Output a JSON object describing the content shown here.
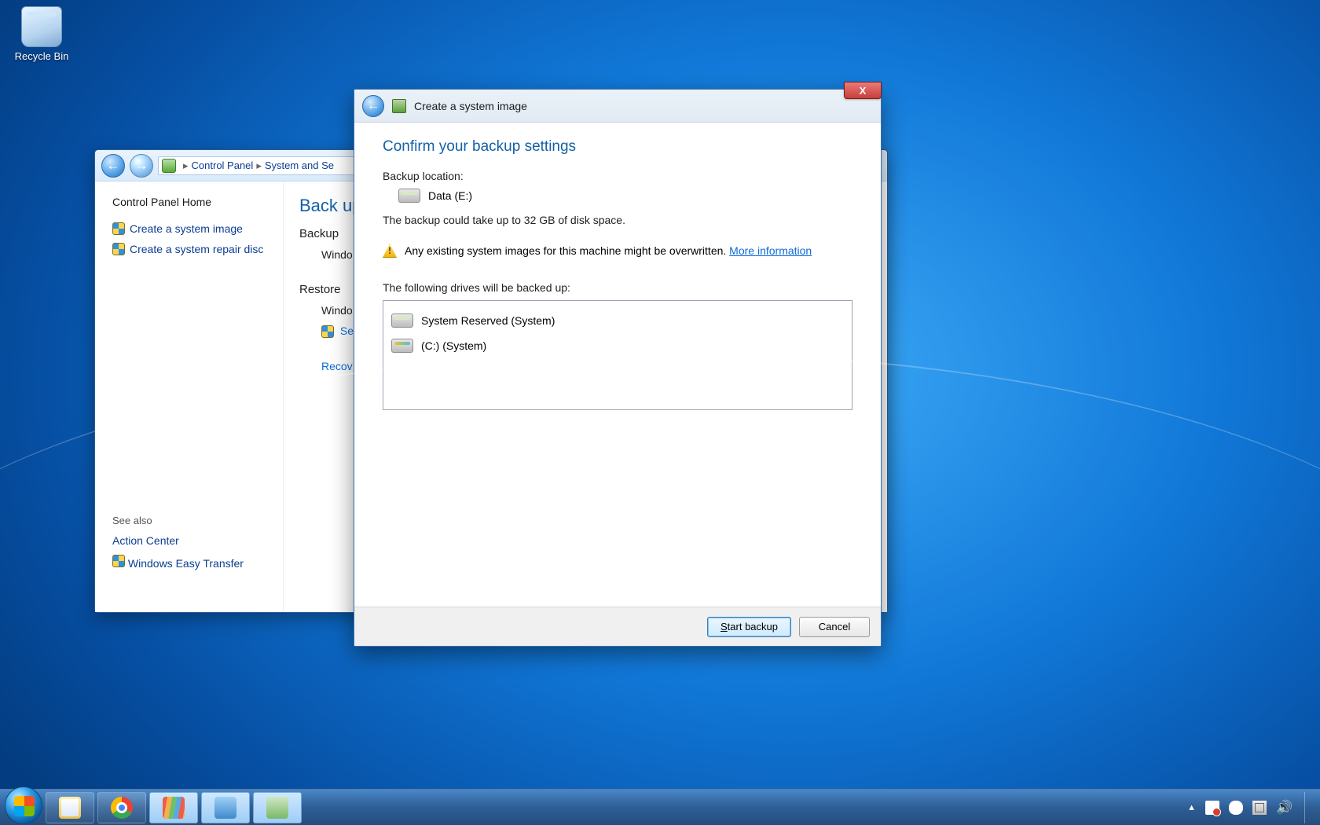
{
  "desktop": {
    "recycle_bin": "Recycle Bin"
  },
  "control_panel": {
    "breadcrumb": {
      "root": "Control Panel",
      "section": "System and Se"
    },
    "home": "Control Panel Home",
    "side_links": {
      "create_image": "Create a system image",
      "create_repair": "Create a system repair disc"
    },
    "see_also": "See also",
    "see_also_links": {
      "action_center": "Action Center",
      "easy_transfer": "Windows Easy Transfer"
    },
    "main": {
      "heading": "Back up",
      "backup_label": "Backup",
      "backup_indent": "Windo",
      "restore_label": "Restore",
      "restore_indent": "Windo",
      "select_link": "Sel",
      "recover_link": "Recov"
    }
  },
  "wizard": {
    "title": "Create a system image",
    "heading": "Confirm your backup settings",
    "backup_location_label": "Backup location:",
    "backup_location_value": "Data (E:)",
    "size_note": "The backup could take up to 32 GB of disk space.",
    "warning_text": "Any existing system images for this machine might be overwritten. ",
    "warning_link": "More information",
    "drives_label": "The following drives will be backed up:",
    "drives": [
      "System Reserved (System)",
      "(C:) (System)"
    ],
    "buttons": {
      "start": "Start backup",
      "cancel": "Cancel"
    }
  },
  "taskbar": {
    "buttons": [
      "file-explorer",
      "chrome",
      "stripes-app",
      "control-panel",
      "backup-app"
    ]
  }
}
